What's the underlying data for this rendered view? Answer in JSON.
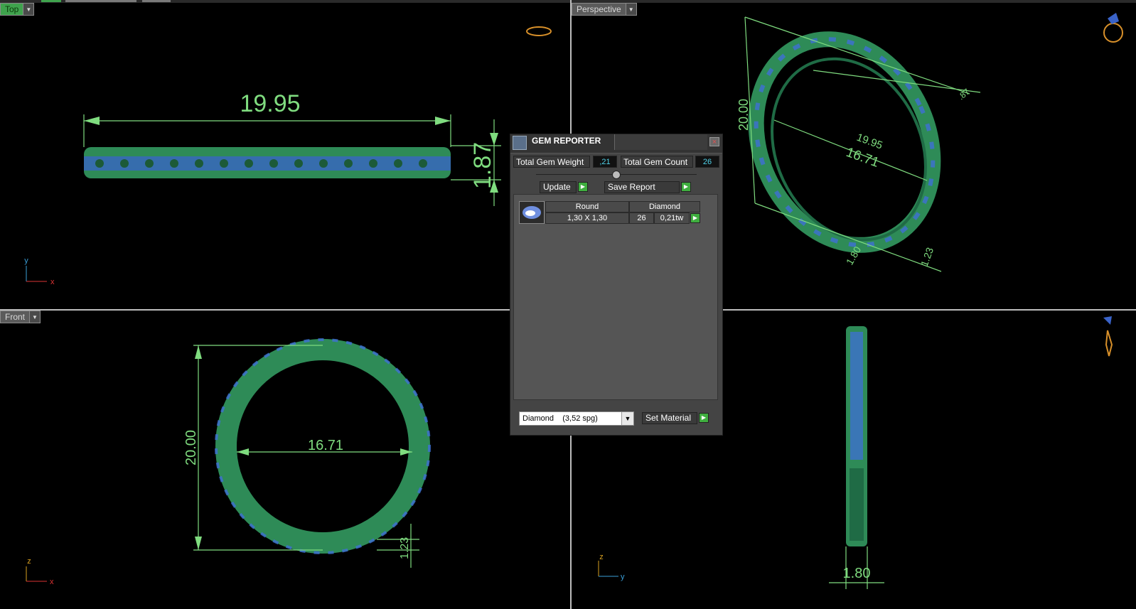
{
  "viewports": {
    "top": {
      "label": "Top",
      "dims": {
        "width": "19.95",
        "height": "1.87"
      },
      "axes": [
        "y",
        "x"
      ]
    },
    "perspective": {
      "label": "Perspective",
      "dims": {
        "outer": "20.00",
        "inner": "16.71",
        "inner2": "19.95",
        "width": "1.80",
        "thick": "1.23",
        "side": ".87"
      }
    },
    "front": {
      "label": "Front",
      "dims": {
        "outer": "20.00",
        "inner": "16.71",
        "thick": "1.23"
      },
      "axes": [
        "z",
        "x"
      ]
    },
    "right": {
      "dims": {
        "width": "1.80"
      },
      "axes": [
        "z",
        "y"
      ]
    }
  },
  "gem_reporter": {
    "title": "GEM REPORTER",
    "close": "×",
    "total_weight_label": "Total Gem Weight",
    "total_weight_value": ",21",
    "total_count_label": "Total Gem Count",
    "total_count_value": "26",
    "update_label": "Update",
    "save_report_label": "Save Report",
    "table": {
      "headers": [
        "Round",
        "Diamond"
      ],
      "row": {
        "size": "1,30 X 1,30",
        "count": "26",
        "weight": "0,21tw"
      }
    },
    "material_select": "Diamond    (3,52 spg)",
    "set_material_label": "Set Material"
  },
  "colors": {
    "accent": "#3fa34d",
    "dim_line": "#7fdc7f",
    "ring": "#2e8b57",
    "gem": "#3f6fd6"
  }
}
